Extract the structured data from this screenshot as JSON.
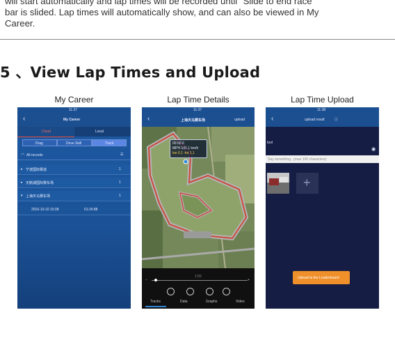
{
  "intro": {
    "line1": "will start automatically and lap times will be recorded until \"Slide to end race",
    "line2": "bar is slided. Lap times will automatically show, and can also be viewed in My",
    "line3": "Career."
  },
  "section": {
    "title": "5 、View Lap Times and Upload"
  },
  "captions": [
    "My Career",
    "Lap Time Details",
    "Lap Time Upload"
  ],
  "screen_career": {
    "status_time": "11:37",
    "title": "My Career",
    "back_glyph": "‹",
    "segments": [
      "Cloud",
      "Local"
    ],
    "tabs": [
      "Drag",
      "Drive Skill",
      "Track"
    ],
    "filter_label": "All records",
    "rows": [
      "宁波国际赛道",
      "天鹅湖国际赛车场",
      "上海天马赛车场"
    ],
    "record": {
      "date": "2016-10-10 10:38",
      "time": "01:24.88"
    }
  },
  "screen_details": {
    "status_time": "11:37",
    "title": "上海天马赛车场",
    "back_glyph": "‹",
    "action": "upload",
    "hud": {
      "l1": "00:00.0",
      "l2": "MPH  141.1 km/h",
      "l3": "lon 0.1   -lnt 1.1"
    },
    "slider_mid": "1:55",
    "tabs": [
      "Tracks",
      "Data",
      "Graphs",
      "Video"
    ],
    "accent": "#2f86d6"
  },
  "screen_upload": {
    "status_time": "11:38",
    "title": "upload result",
    "back_glyph": "‹",
    "side_label": "tool",
    "input_placeholder": "Say something...(max 100 characters)",
    "add_glyph": "+",
    "button_label": "Upload to the Leaderboard",
    "button_color": "#f0902a"
  }
}
